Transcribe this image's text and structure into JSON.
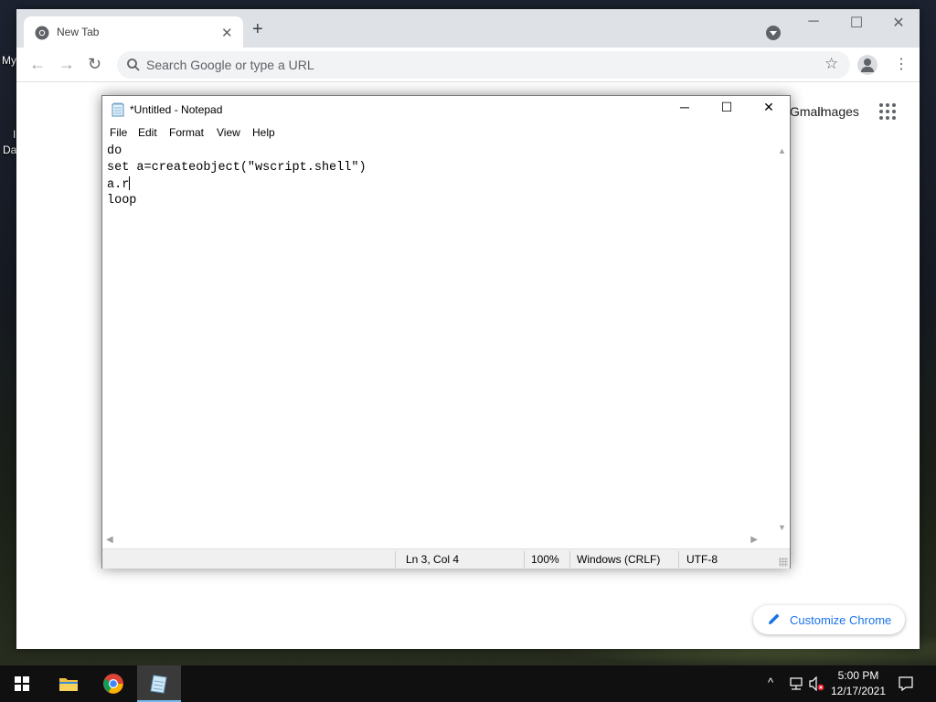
{
  "desktop": {
    "icon_label_1": "My",
    "icon_label_2": "I",
    "icon_label_3": "Da"
  },
  "chrome": {
    "tab_title": "New Tab",
    "tab_close": "✕",
    "new_tab": "+",
    "minimize": "─",
    "maximize": "☐",
    "close": "✕",
    "back": "←",
    "forward": "→",
    "reload": "↻",
    "omnibox_placeholder": "Search Google or type a URL",
    "bookmark_star": "☆",
    "menu": "⋮",
    "gmail_label": "Gmail",
    "images_label": "Images",
    "customize_label": "Customize Chrome",
    "accent_color": "#1a73e8"
  },
  "notepad": {
    "title": "*Untitled - Notepad",
    "minimize": "─",
    "maximize": "☐",
    "close": "✕",
    "menus": [
      "File",
      "Edit",
      "Format",
      "View",
      "Help"
    ],
    "lines": [
      "do",
      "set a=createobject(\"wscript.shell\")",
      "a.r",
      "loop"
    ],
    "status": {
      "position": "Ln 3, Col 4",
      "zoom": "100%",
      "line_endings": "Windows (CRLF)",
      "encoding": "UTF-8"
    }
  },
  "taskbar": {
    "apps": [
      "start-button",
      "file-explorer",
      "chrome",
      "notepad"
    ],
    "active_app": "notepad",
    "tray_chevron": "^",
    "time": "5:00 PM",
    "date": "12/17/2021"
  }
}
